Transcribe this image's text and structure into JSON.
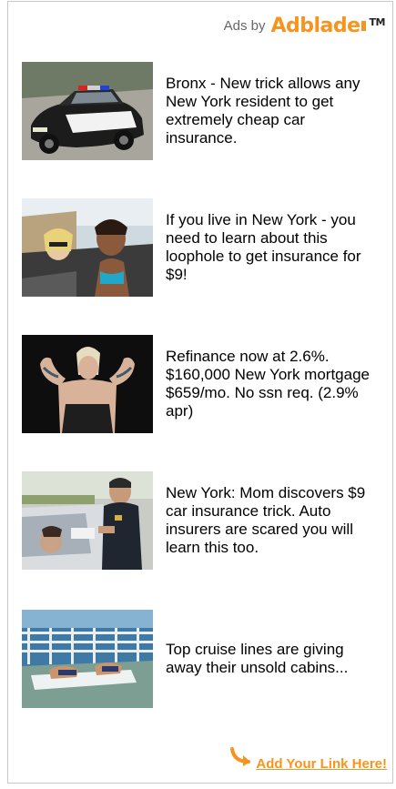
{
  "header": {
    "ads_by": "Ads by",
    "brand_ad": "Ad",
    "brand_blade": "blade",
    "brand_tm": "TM"
  },
  "ads": [
    {
      "text": "Bronx - New trick allows any New York resident to get extremely cheap car insurance."
    },
    {
      "text": "If you live in New York - you need to learn about this loophole to get insurance for $9!"
    },
    {
      "text": "Refinance now at 2.6%. $160,000 New York mortgage $659/mo. No ssn req. (2.9% apr)"
    },
    {
      "text": "New York: Mom discovers $9 car insurance trick. Auto insurers are scared you will learn this too."
    },
    {
      "text": "Top cruise lines are giving away their unsold cabins..."
    }
  ],
  "footer": {
    "link_text": "Add Your Link Here!"
  },
  "colors": {
    "brand_orange": "#f7941d",
    "frame_border": "#c8c8c8",
    "muted_text": "#666666"
  },
  "icons": {
    "brand_arrow": "curved-arrow-icon"
  }
}
